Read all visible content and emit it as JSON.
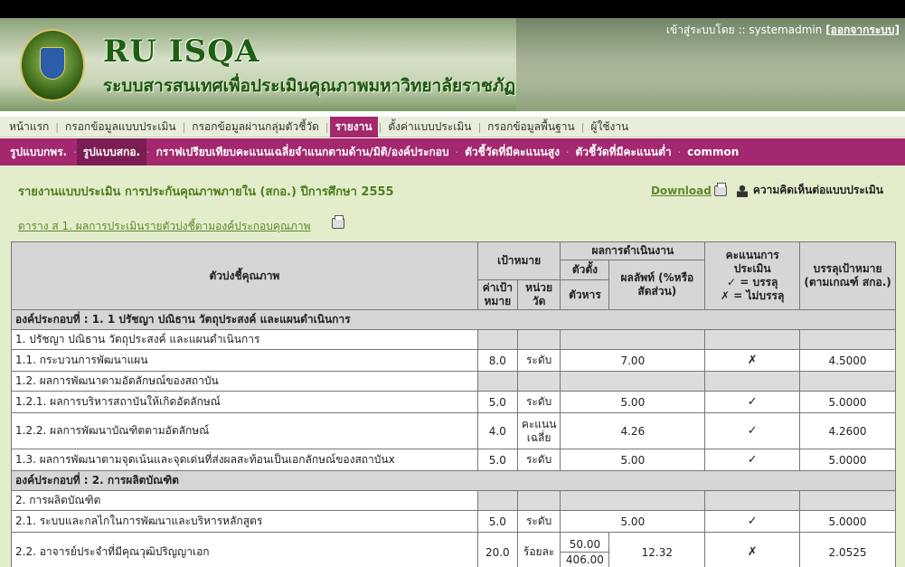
{
  "header": {
    "app_title": "RU ISQA",
    "app_subtitle": "ระบบสารสนเทศเพื่อประเมินคุณภาพมหาวิทยาลัยราชภัฏ",
    "login_prefix": "เข้าสู่ระบบโดย :: systemadmin",
    "logout_label": "[ออกจากระบบ]"
  },
  "menu1": {
    "items": [
      "หน้าแรก",
      "กรอกข้อมูลแบบประเมิน",
      "กรอกข้อมูลผ่านกลุ่มตัวชี้วัด",
      "รายงาน",
      "ตั้งค่าแบบประเมิน",
      "กรอกข้อมูลพื้นฐาน",
      "ผู้ใช้งาน"
    ]
  },
  "menu2": {
    "items": [
      "รูปแบบกพร.",
      "รูปแบบสกอ.",
      "กราฟเปรียบเทียบคะแนนเฉลี่ยจำแนกตามด้าน/มิติ/องค์ประกอบ",
      "ตัวชี้วัดที่มีคะแนนสูง",
      "ตัวชี้วัดที่มีคะแนนต่ำ",
      "common"
    ]
  },
  "content": {
    "report_title": "รายงานแบบประเมิน การประกันคุณภาพภายใน (สกอ.) ปีการศึกษา 2555",
    "download_label": "Download",
    "comment_label": "ความคิดเห็นต่อแบบประเมิน",
    "table_link": "ตาราง ส 1. ผลการประเมินรายตัวบ่งชี้ตามองค์ประกอบคุณภาพ"
  },
  "table": {
    "headers": {
      "indicator": "ตัวบ่งชี้คุณภาพ",
      "target": "เป้าหมาย",
      "target_value": "ค่าเป้าหมาย",
      "unit": "หน่วยวัด",
      "performance": "ผลการดำเนินงาน",
      "numerator_divisor": "ตัวตั้ง",
      "divisor": "ตัวหาร",
      "result": "ผลลัพท์ (%หรือสัดส่วน)",
      "score": "คะแนนการประเมิน",
      "score_legend_pass": "✓ = บรรลุ",
      "score_legend_fail": "✗ = ไม่บรรลุ",
      "achieve": "บรรลุเป้าหมาย (ตามเกณฑ์ สกอ.)"
    },
    "rows": {
      "g1": "องค์ประกอบที่ : 1. 1 ปรัชญา ปณิธาน วัตถุประสงค์ และแผนดำเนินการ",
      "r1_label": "1. ปรัชญา ปณิธาน วัตถุประสงค์ และแผนดำเนินการ",
      "r11": {
        "label": "1.1. กระบวนการพัฒนาแผน",
        "target": "8.0",
        "unit": "ระดับ",
        "result": "7.00",
        "mark": "✗",
        "score": "4.5000"
      },
      "r12_label": "1.2. ผลการพัฒนาตามอัตลักษณ์ของสถาบัน",
      "r121": {
        "label": "1.2.1. ผลการบริหารสถาบันให้เกิดอัตลักษณ์",
        "target": "5.0",
        "unit": "ระดับ",
        "result": "5.00",
        "mark": "✓",
        "score": "5.0000"
      },
      "r122": {
        "label": "1.2.2. ผลการพัฒนาบัณฑิตตามอัตลักษณ์",
        "target": "4.0",
        "unit": "คะแนนเฉลี่ย",
        "result": "4.26",
        "mark": "✓",
        "score": "4.2600"
      },
      "r13": {
        "label": "1.3. ผลการพัฒนาตามจุดเน้นและจุดเด่นที่ส่งผลสะท้อนเป็นเอกลักษณ์ของสถาบันx",
        "target": "5.0",
        "unit": "ระดับ",
        "result": "5.00",
        "mark": "✓",
        "score": "5.0000"
      },
      "g2": "องค์ประกอบที่ : 2. การผลิตบัณฑิต",
      "r2_label": "2. การผลิตบัณฑิต",
      "r21": {
        "label": "2.1. ระบบและกลไกในการพัฒนาและบริหารหลักสูตร",
        "target": "5.0",
        "unit": "ระดับ",
        "result": "5.00",
        "mark": "✓",
        "score": "5.0000"
      },
      "r22": {
        "label": "2.2. อาจารย์ประจำที่มีคุณวุฒิปริญญาเอก",
        "target": "20.0",
        "unit": "ร้อยละ",
        "numerator": "50.00",
        "divisor": "406.00",
        "result": "12.32",
        "mark": "✗",
        "score": "2.0525"
      }
    }
  }
}
